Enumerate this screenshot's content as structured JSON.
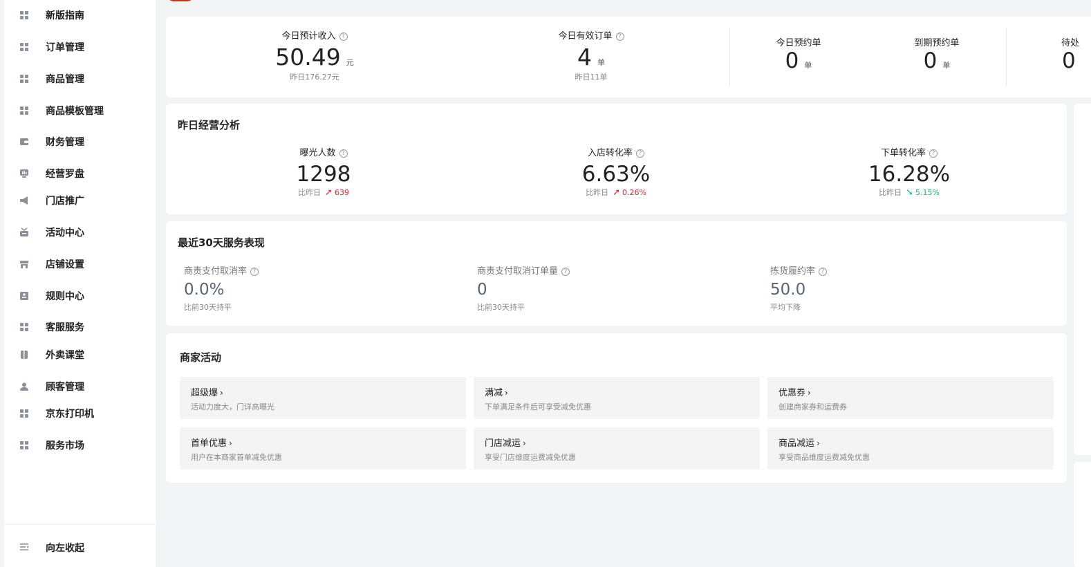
{
  "sidebar": {
    "items": [
      {
        "label": "新版指南",
        "icon": "grid-icon"
      },
      {
        "label": "订单管理",
        "icon": "grid-icon"
      },
      {
        "label": "商品管理",
        "icon": "grid-icon"
      },
      {
        "label": "商品模板管理",
        "icon": "grid-icon"
      },
      {
        "label": "财务管理",
        "icon": "wallet-icon"
      },
      {
        "label": "经营罗盘",
        "icon": "monitor-icon"
      },
      {
        "label": "门店推广",
        "icon": "megaphone-icon"
      },
      {
        "label": "活动中心",
        "icon": "gift-icon"
      },
      {
        "label": "店铺设置",
        "icon": "store-icon"
      },
      {
        "label": "规则中心",
        "icon": "rules-icon"
      },
      {
        "label": "客服服务",
        "icon": "grid-icon"
      },
      {
        "label": "外卖课堂",
        "icon": "book-icon"
      },
      {
        "label": "顾客管理",
        "icon": "user-icon"
      },
      {
        "label": "京东打印机",
        "icon": "grid-icon"
      },
      {
        "label": "服务市场",
        "icon": "grid-icon"
      }
    ],
    "collapse_label": "向左收起"
  },
  "today": {
    "income": {
      "label": "今日预计收入",
      "value": "50.49",
      "unit": "元",
      "sub": "昨日176.27元"
    },
    "orders": {
      "label": "今日有效订单",
      "value": "4",
      "unit": "单",
      "sub": "昨日11单"
    },
    "reservations": {
      "label": "今日预约单",
      "value": "0",
      "unit": "单"
    },
    "expiring": {
      "label": "到期预约单",
      "value": "0",
      "unit": "单"
    },
    "pending": {
      "label": "待处",
      "value": "0"
    }
  },
  "analysis": {
    "title": "昨日经营分析",
    "compare_label": "比昨日",
    "metrics": [
      {
        "label": "曝光人数",
        "value": "1298",
        "trend": "up",
        "change": "639"
      },
      {
        "label": "入店转化率",
        "value": "6.63%",
        "trend": "up",
        "change": "0.26%"
      },
      {
        "label": "下单转化率",
        "value": "16.28%",
        "trend": "down",
        "change": "5.15%"
      }
    ]
  },
  "service": {
    "title": "最近30天服务表现",
    "metrics": [
      {
        "label": "商责支付取消率",
        "value": "0.0%",
        "sub": "比前30天持平"
      },
      {
        "label": "商责支付取消订单量",
        "value": "0",
        "sub": "比前30天持平"
      },
      {
        "label": "拣货履约率",
        "value": "50.0",
        "sub": "平均下降"
      }
    ]
  },
  "activities": {
    "title": "商家活动",
    "items": [
      {
        "title": "超级爆",
        "desc": "活动力度大，门详高曝光"
      },
      {
        "title": "满减",
        "desc": "下单满足条件后可享受减免优惠"
      },
      {
        "title": "优惠券",
        "desc": "创建商家券和运费券"
      },
      {
        "title": "首单优惠",
        "desc": "用户在本商家首单减免优惠"
      },
      {
        "title": "门店减运",
        "desc": "享受门店维度运费减免优惠"
      },
      {
        "title": "商品减运",
        "desc": "享受商品维度运费减免优惠"
      }
    ]
  },
  "colors": {
    "trend_up": "#e8202a",
    "trend_down": "#16b870",
    "background": "#f2f3f5",
    "card": "#ffffff"
  }
}
